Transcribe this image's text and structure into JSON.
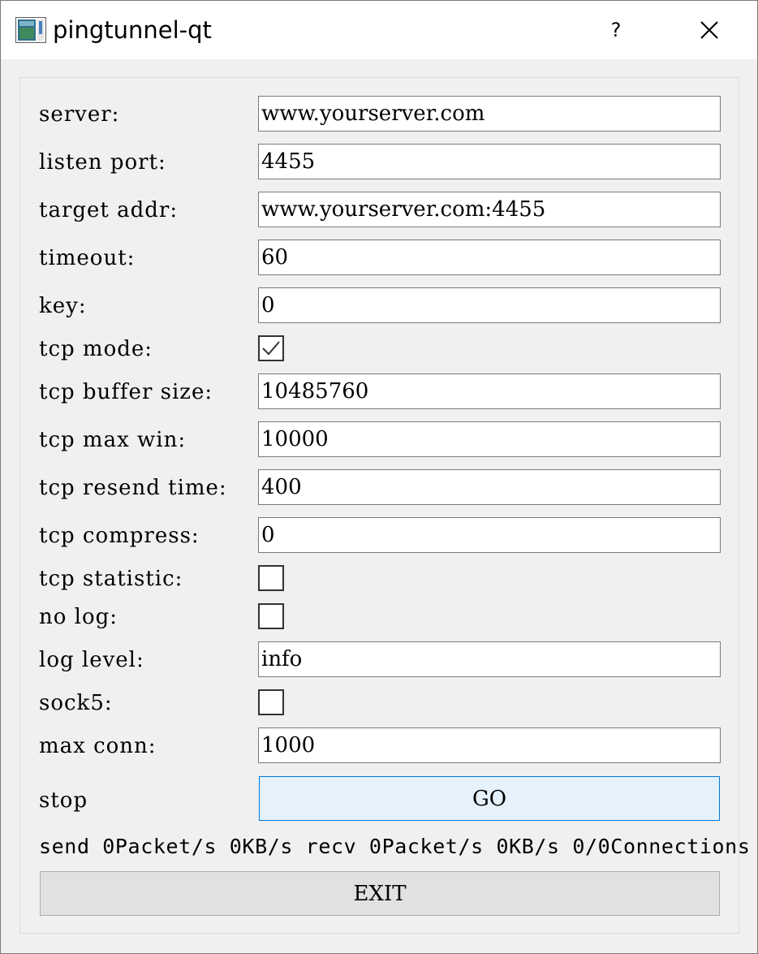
{
  "window": {
    "title": "pingtunnel-qt",
    "help_glyph": "?",
    "app_icon": "window-app-icon",
    "close_icon": "close-icon"
  },
  "form": {
    "server": {
      "label": "server:",
      "value": "www.yourserver.com"
    },
    "listen_port": {
      "label": "listen port:",
      "value": "4455"
    },
    "target_addr": {
      "label": "target addr:",
      "value": "www.yourserver.com:4455"
    },
    "timeout": {
      "label": "timeout:",
      "value": "60"
    },
    "key": {
      "label": "key:",
      "value": "0"
    },
    "tcp_mode": {
      "label": "tcp mode:",
      "checked": true
    },
    "tcp_buffer_size": {
      "label": "tcp buffer size:",
      "value": "10485760"
    },
    "tcp_max_win": {
      "label": "tcp max win:",
      "value": "10000"
    },
    "tcp_resend_time": {
      "label": "tcp resend time:",
      "value": "400"
    },
    "tcp_compress": {
      "label": "tcp compress:",
      "value": "0"
    },
    "tcp_statistic": {
      "label": "tcp statistic:",
      "checked": false
    },
    "no_log": {
      "label": "no log:",
      "checked": false
    },
    "log_level": {
      "label": "log level:",
      "value": "info"
    },
    "sock5": {
      "label": "sock5:",
      "checked": false
    },
    "max_conn": {
      "label": "max conn:",
      "value": "1000"
    }
  },
  "controls": {
    "state_text": "stop",
    "go_label": "GO",
    "status_text": "send 0Packet/s 0KB/s recv 0Packet/s 0KB/s 0/0Connections",
    "exit_label": "EXIT"
  },
  "colors": {
    "go_bg": "#e5f1fb",
    "go_border": "#0078d7",
    "exit_bg": "#e1e1e1"
  }
}
